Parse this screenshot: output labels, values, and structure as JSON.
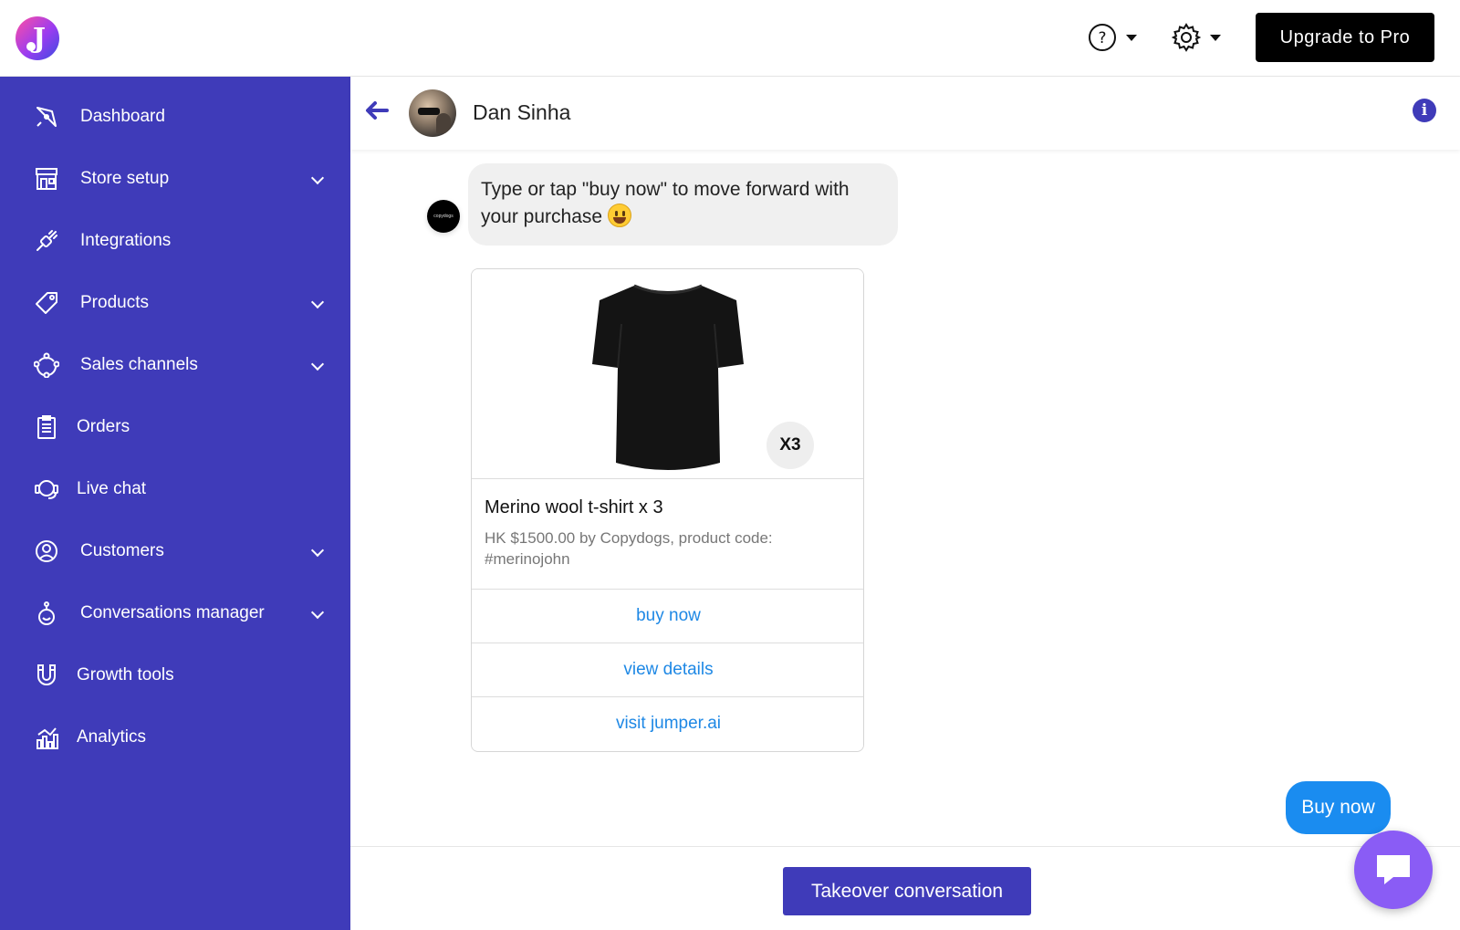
{
  "brand": {
    "logo_letter": "J",
    "accent": "#3f3bb9"
  },
  "topbar": {
    "help_icon": "help-circle-icon",
    "settings_icon": "gear-icon",
    "upgrade_label": "Upgrade to Pro"
  },
  "sidebar": {
    "collapse_glyph": "«",
    "items": [
      {
        "label": "Dashboard",
        "icon": "rocket-icon",
        "expandable": false
      },
      {
        "label": "Store setup",
        "icon": "store-icon",
        "expandable": true
      },
      {
        "label": "Integrations",
        "icon": "plug-icon",
        "expandable": false
      },
      {
        "label": "Products",
        "icon": "tag-icon",
        "expandable": true
      },
      {
        "label": "Sales channels",
        "icon": "channels-icon",
        "expandable": true
      },
      {
        "label": "Orders",
        "icon": "clipboard-icon",
        "expandable": false
      },
      {
        "label": "Live chat",
        "icon": "headset-icon",
        "expandable": false
      },
      {
        "label": "Customers",
        "icon": "user-circle-icon",
        "expandable": true
      },
      {
        "label": "Conversations manager",
        "icon": "bot-icon",
        "expandable": true
      },
      {
        "label": "Growth tools",
        "icon": "magnet-icon",
        "expandable": false
      },
      {
        "label": "Analytics",
        "icon": "analytics-icon",
        "expandable": false
      }
    ]
  },
  "chat": {
    "contact_name": "Dan Sinha",
    "bot_avatar_text": "copydogs",
    "incoming_message": "Type or tap \"buy now\" to move forward with your purchase",
    "product_card": {
      "quantity_badge": "X3",
      "title": "Merino wool t-shirt x 3",
      "subtitle": "HK $1500.00 by Copydogs, product code: #merinojohn",
      "buttons": [
        "buy now",
        "view details",
        "visit jumper.ai"
      ]
    },
    "outgoing_message": "Buy now",
    "takeover_label": "Takeover conversation"
  }
}
